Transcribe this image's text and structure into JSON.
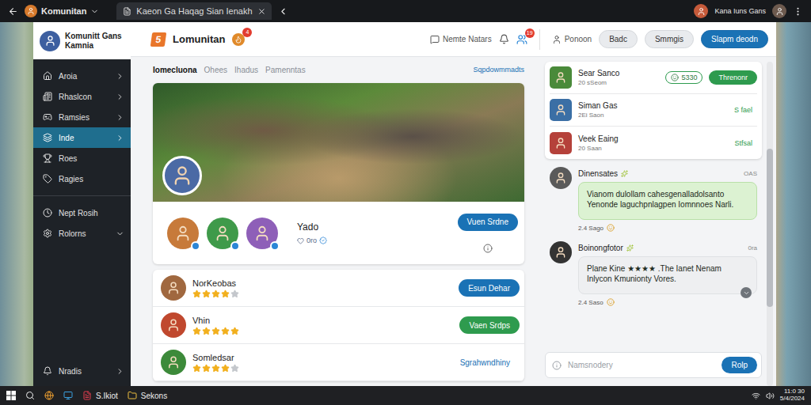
{
  "browser": {
    "profile": "Komunitan",
    "tab": "Kaeon Ga Haqag Sian Ienakh",
    "account": "Kana Iuns Gans"
  },
  "sidebar": {
    "title": "Komunitt Gans Kamnia",
    "groups": [
      {
        "items": [
          {
            "label": "Aroia",
            "kind": "group",
            "expanded": false,
            "selected": false
          },
          {
            "label": "Rhaslcon",
            "kind": "group",
            "expanded": false,
            "selected": false
          },
          {
            "label": "Ramsies",
            "kind": "group",
            "expanded": false,
            "selected": false
          },
          {
            "label": "Inde",
            "kind": "group",
            "expanded": false,
            "selected": true
          },
          {
            "label": "Roes",
            "kind": "link",
            "expanded": false,
            "selected": false
          },
          {
            "label": "Ragies",
            "kind": "link",
            "expanded": false,
            "selected": false
          }
        ]
      },
      {
        "items": [
          {
            "label": "Nept Rosih",
            "kind": "link",
            "expanded": false,
            "selected": false
          },
          {
            "label": "Rolorns",
            "kind": "group",
            "expanded": true,
            "selected": false
          }
        ]
      }
    ],
    "footer": {
      "label": "Nradis"
    }
  },
  "header": {
    "logo": "5",
    "title": "Lomunitan",
    "title_badge": "4",
    "link": "Nemte Natars",
    "friends_badge": "19",
    "profile": "Ponoon",
    "buttons": [
      {
        "label": "Badc",
        "primary": false
      },
      {
        "label": "Smmgis",
        "primary": false
      },
      {
        "label": "Slapm deodn",
        "primary": true
      }
    ]
  },
  "feed": {
    "tabs": [
      {
        "label": "Iomecluona",
        "selected": true
      },
      {
        "label": "Ohees",
        "selected": false
      },
      {
        "label": "Ihadus",
        "selected": false
      },
      {
        "label": "Pamenntas",
        "selected": false
      }
    ],
    "link": "Sqpdowmmadts",
    "featured": {
      "name": "Yado",
      "meta": "0ro",
      "button": "Vuen Srdne",
      "members": [
        {
          "color": "#c77a3a"
        },
        {
          "color": "#3f9a4a"
        },
        {
          "color": "#8e5fb8"
        }
      ]
    },
    "games": [
      {
        "name": "NorKeobas",
        "stars": 4,
        "color": "#a0683f",
        "action": {
          "label": "Esun Dehar",
          "kind": "primary"
        }
      },
      {
        "name": "Vhin",
        "stars": 5,
        "color": "#c0482e",
        "action": {
          "label": "Vaen Srdps",
          "kind": "success"
        }
      },
      {
        "name": "Somledsar",
        "stars": 4,
        "color": "#3c8a3a",
        "action": {
          "label": "Sgrahwndhiny",
          "kind": "link"
        }
      }
    ]
  },
  "friends": [
    {
      "name": "Sear Sanco",
      "time": "20 sSeom",
      "color": "#4a8a3a",
      "kind": "button",
      "count": "5330",
      "action": "Threnonr"
    },
    {
      "name": "Siman Gas",
      "time": "2Ei Saon",
      "color": "#3b6fa5",
      "kind": "text",
      "count": "",
      "action": "S fael"
    },
    {
      "name": "Veek Eaing",
      "time": "20 Saan",
      "color": "#b5413a",
      "kind": "text",
      "count": "",
      "action": "Stfsal"
    }
  ],
  "chat": {
    "messages": [
      {
        "author": "Dinensates",
        "stamp": "OAS",
        "text": "Vianom dulollam cahesgenalladolsanto Yenonde laguchpnlagpen Iomnnoes Narli.",
        "sent": "2.4 Sago",
        "kind": "highlight",
        "color": "#5a5a5a"
      },
      {
        "author": "Boinongfotor",
        "stamp": "0ra",
        "text": "Plane Kine ★★★★ .The Ianet Nenam Inlycon Kmunionty Vores.",
        "sent": "2.4 Saso",
        "kind": "plain",
        "color": "#333333"
      }
    ],
    "input": {
      "placeholder": "Namsnodery"
    },
    "send": "Rolp"
  },
  "taskbar": {
    "apps": [
      {
        "label": "S.Ikiot"
      },
      {
        "label": "Sekons"
      }
    ],
    "time": "11:0 30",
    "date": "5/4/2024"
  }
}
